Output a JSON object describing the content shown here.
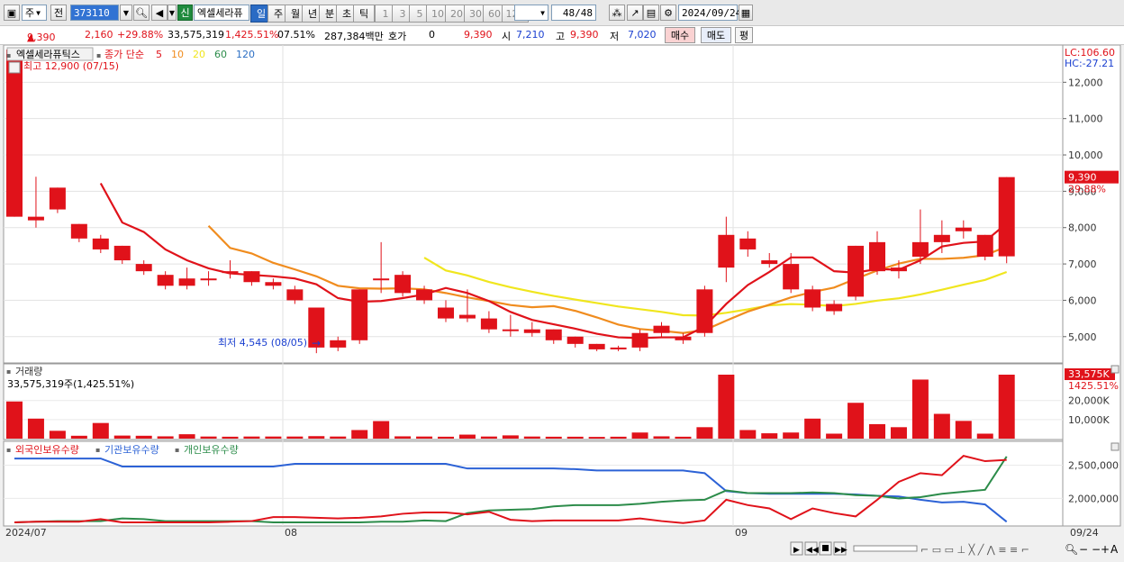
{
  "toolbar": {
    "period_select": "주",
    "prev_label": "전",
    "stock_code": "373110",
    "credit_tag": "신",
    "stock_name": "엑셀세라퓨",
    "periods": [
      "일",
      "주",
      "월",
      "년",
      "분",
      "초",
      "틱"
    ],
    "selected_period": "일",
    "intervals": [
      "1",
      "3",
      "5",
      "10",
      "20",
      "30",
      "60",
      "120"
    ],
    "count": "48/48",
    "date": "2024/09/24"
  },
  "quote": {
    "price": "9,390",
    "change": "2,160",
    "change_pct": "+29.88%",
    "volume": "33,575,319",
    "volume_pct": "1,425.51%",
    "turnover": "07.51%",
    "amount": "287,384백만",
    "hoga_label": "호가",
    "hoga_value": "0",
    "hoga_price": "9,390",
    "open_label": "시",
    "open": "7,210",
    "high_label": "고",
    "high": "9,390",
    "low_label": "저",
    "low": "7,020",
    "buy_label": "매수",
    "sell_label": "매도",
    "eval_label": "평"
  },
  "price_panel": {
    "stock_label": "엑셀세라퓨틱스",
    "ma_label": "종가 단순",
    "ma_periods": [
      {
        "label": "5",
        "color": "#e0121a"
      },
      {
        "label": "10",
        "color": "#f08c1e"
      },
      {
        "label": "20",
        "color": "#f0e61e"
      },
      {
        "label": "60",
        "color": "#2c8c4a"
      },
      {
        "label": "120",
        "color": "#2c6fc4"
      }
    ],
    "high_note": "최고 12,900 (07/15)",
    "low_note": "최저 4,545 (08/05)",
    "lc": "LC:106.60",
    "hc": "HC:-27.21",
    "price_tag": "9,390",
    "pct_tag": "29.88%",
    "y_ticks": [
      "12,000",
      "11,000",
      "10,000",
      "9,000",
      "8,000",
      "7,000",
      "6,000",
      "5,000"
    ]
  },
  "volume_panel": {
    "label": "거래량",
    "value": "33,575,319주(1,425.51%)",
    "tag": "33,575K",
    "pct_tag": "1425.51%",
    "y_ticks": [
      "20,000K",
      "10,000K"
    ]
  },
  "holdings_panel": {
    "labels": [
      "외국인보유수량",
      "기관보유수량",
      "개인보유수량"
    ],
    "y_ticks": [
      "2,500,000",
      "2,000,000"
    ]
  },
  "xaxis": {
    "start": "2024/07",
    "aug": "08",
    "sep": "09",
    "end": "09/24"
  },
  "chart_data": {
    "type": "candlestick",
    "ylim": [
      4350,
      12950
    ],
    "candles": [
      {
        "o": 8300,
        "h": 12900,
        "l": 8300,
        "c": 12900
      },
      {
        "o": 8200,
        "h": 9400,
        "l": 8000,
        "c": 8300
      },
      {
        "o": 8500,
        "h": 9100,
        "l": 8400,
        "c": 9100
      },
      {
        "o": 7700,
        "h": 8100,
        "l": 7600,
        "c": 8100
      },
      {
        "o": 7400,
        "h": 7800,
        "l": 7300,
        "c": 7700
      },
      {
        "o": 7100,
        "h": 7500,
        "l": 7000,
        "c": 7500
      },
      {
        "o": 6800,
        "h": 7100,
        "l": 6700,
        "c": 7000
      },
      {
        "o": 6400,
        "h": 6800,
        "l": 6300,
        "c": 6700
      },
      {
        "o": 6400,
        "h": 6900,
        "l": 6300,
        "c": 6600
      },
      {
        "o": 6600,
        "h": 6800,
        "l": 6400,
        "c": 6600
      },
      {
        "o": 6800,
        "h": 7100,
        "l": 6600,
        "c": 6800
      },
      {
        "o": 6500,
        "h": 6800,
        "l": 6400,
        "c": 6800
      },
      {
        "o": 6400,
        "h": 6600,
        "l": 6300,
        "c": 6500
      },
      {
        "o": 6000,
        "h": 6400,
        "l": 5900,
        "c": 6300
      },
      {
        "o": 4700,
        "h": 5800,
        "l": 4545,
        "c": 5800
      },
      {
        "o": 4700,
        "h": 5000,
        "l": 4600,
        "c": 4900
      },
      {
        "o": 4900,
        "h": 6300,
        "l": 4800,
        "c": 6300
      },
      {
        "o": 6600,
        "h": 7600,
        "l": 6200,
        "c": 6600
      },
      {
        "o": 6200,
        "h": 6800,
        "l": 6100,
        "c": 6700
      },
      {
        "o": 6000,
        "h": 6400,
        "l": 5900,
        "c": 6300
      },
      {
        "o": 5500,
        "h": 6000,
        "l": 5400,
        "c": 5800
      },
      {
        "o": 5500,
        "h": 6300,
        "l": 5400,
        "c": 5600
      },
      {
        "o": 5200,
        "h": 5700,
        "l": 5100,
        "c": 5500
      },
      {
        "o": 5200,
        "h": 5600,
        "l": 5000,
        "c": 5200
      },
      {
        "o": 5100,
        "h": 5400,
        "l": 5000,
        "c": 5200
      },
      {
        "o": 4900,
        "h": 5200,
        "l": 4800,
        "c": 5200
      },
      {
        "o": 4800,
        "h": 5000,
        "l": 4700,
        "c": 5000
      },
      {
        "o": 4650,
        "h": 4800,
        "l": 4600,
        "c": 4800
      },
      {
        "o": 4650,
        "h": 4750,
        "l": 4600,
        "c": 4700
      },
      {
        "o": 4700,
        "h": 5200,
        "l": 4600,
        "c": 5100
      },
      {
        "o": 5100,
        "h": 5400,
        "l": 5000,
        "c": 5300
      },
      {
        "o": 4900,
        "h": 5100,
        "l": 4800,
        "c": 5000
      },
      {
        "o": 5100,
        "h": 6400,
        "l": 5000,
        "c": 6300
      },
      {
        "o": 6900,
        "h": 8300,
        "l": 6500,
        "c": 7800
      },
      {
        "o": 7400,
        "h": 7900,
        "l": 7200,
        "c": 7700
      },
      {
        "o": 7000,
        "h": 7300,
        "l": 6900,
        "c": 7100
      },
      {
        "o": 6300,
        "h": 7300,
        "l": 6200,
        "c": 7000
      },
      {
        "o": 5800,
        "h": 6400,
        "l": 5700,
        "c": 6300
      },
      {
        "o": 5700,
        "h": 6000,
        "l": 5600,
        "c": 5900
      },
      {
        "o": 6100,
        "h": 7500,
        "l": 6000,
        "c": 7500
      },
      {
        "o": 6800,
        "h": 7900,
        "l": 6700,
        "c": 7600
      },
      {
        "o": 6800,
        "h": 7100,
        "l": 6600,
        "c": 6900
      },
      {
        "o": 7200,
        "h": 8500,
        "l": 7000,
        "c": 7600
      },
      {
        "o": 7600,
        "h": 8200,
        "l": 7300,
        "c": 7800
      },
      {
        "o": 7900,
        "h": 8200,
        "l": 7700,
        "c": 8000
      },
      {
        "o": 7200,
        "h": 7800,
        "l": 7100,
        "c": 7800
      },
      {
        "o": 7210,
        "h": 9390,
        "l": 7020,
        "c": 9390
      }
    ],
    "volumes": [
      19500,
      10500,
      4100,
      1500,
      8200,
      1600,
      1500,
      1200,
      2300,
      1100,
      1000,
      1100,
      1100,
      1100,
      1300,
      1100,
      4500,
      9200,
      1200,
      1100,
      1000,
      2100,
      1100,
      1700,
      1100,
      1000,
      1000,
      900,
      1000,
      3200,
      1200,
      1000,
      6000,
      33575,
      4500,
      2800,
      3200,
      10500,
      2600,
      18800,
      7600,
      6000,
      31000,
      13000,
      9300,
      2600,
      33575
    ],
    "vol_max": 33575,
    "foreign_holdings": [
      1640000,
      1650000,
      1650000,
      1650000,
      1690000,
      1640000,
      1640000,
      1640000,
      1640000,
      1640000,
      1650000,
      1660000,
      1720000,
      1720000,
      1710000,
      1700000,
      1710000,
      1730000,
      1770000,
      1790000,
      1790000,
      1760000,
      1800000,
      1680000,
      1660000,
      1670000,
      1670000,
      1670000,
      1670000,
      1700000,
      1660000,
      1630000,
      1670000,
      1980000,
      1900000,
      1850000,
      1690000,
      1850000,
      1780000,
      1730000,
      1980000,
      2250000,
      2380000,
      2350000,
      2640000,
      2560000,
      2580000
    ],
    "institution_holdings": [
      2600000,
      2600000,
      2600000,
      2600000,
      2600000,
      2480000,
      2480000,
      2480000,
      2480000,
      2480000,
      2480000,
      2480000,
      2480000,
      2520000,
      2520000,
      2520000,
      2520000,
      2520000,
      2520000,
      2520000,
      2520000,
      2450000,
      2450000,
      2450000,
      2450000,
      2450000,
      2440000,
      2420000,
      2420000,
      2420000,
      2420000,
      2420000,
      2380000,
      2110000,
      2080000,
      2070000,
      2070000,
      2070000,
      2070000,
      2060000,
      2040000,
      2030000,
      1980000,
      1940000,
      1950000,
      1910000,
      1650000
    ],
    "individual_holdings": [
      1640000,
      1650000,
      1660000,
      1660000,
      1660000,
      1700000,
      1690000,
      1660000,
      1660000,
      1660000,
      1660000,
      1660000,
      1640000,
      1640000,
      1640000,
      1640000,
      1640000,
      1650000,
      1650000,
      1670000,
      1660000,
      1780000,
      1820000,
      1830000,
      1840000,
      1880000,
      1900000,
      1900000,
      1900000,
      1920000,
      1950000,
      1970000,
      1980000,
      2120000,
      2080000,
      2080000,
      2080000,
      2090000,
      2080000,
      2050000,
      2040000,
      2000000,
      2020000,
      2070000,
      2100000,
      2130000,
      2630000
    ],
    "hold_ylim": [
      1600000,
      2750000
    ],
    "ma_colors": {
      "ma5": "#e0121a",
      "ma10": "#f08c1e",
      "ma20": "#f0e61e"
    }
  }
}
